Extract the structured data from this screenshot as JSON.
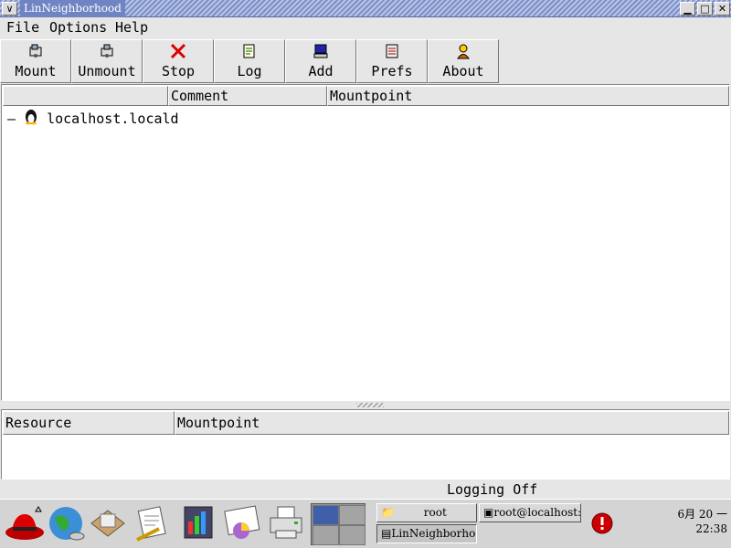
{
  "window": {
    "title": "LinNeighborhood"
  },
  "menu": [
    "File",
    "Options",
    "Help"
  ],
  "toolbar": [
    {
      "label": "Mount",
      "icon": "mount-icon"
    },
    {
      "label": "Unmount",
      "icon": "unmount-icon"
    },
    {
      "label": "Stop",
      "icon": "stop-icon"
    },
    {
      "label": "Log",
      "icon": "log-icon"
    },
    {
      "label": "Add",
      "icon": "add-icon"
    },
    {
      "label": "Prefs",
      "icon": "prefs-icon"
    },
    {
      "label": "About",
      "icon": "about-icon"
    }
  ],
  "tree": {
    "columns": [
      "",
      "Comment",
      "Mountpoint"
    ],
    "rows": [
      {
        "name": "localhost.locald",
        "icon": "tux-icon"
      }
    ]
  },
  "resources": {
    "columns": [
      "Resource",
      "Mountpoint"
    ]
  },
  "status": {
    "text": "Logging Off"
  },
  "taskbar": {
    "tasks": [
      {
        "label": "root",
        "icon": "folder-icon"
      },
      {
        "label": "root@localhost:/m",
        "icon": "terminal-icon"
      },
      {
        "label": "LinNeighborhood",
        "icon": "app-icon"
      }
    ],
    "clock": {
      "date": "6月 20 一",
      "time": "22:38"
    }
  }
}
